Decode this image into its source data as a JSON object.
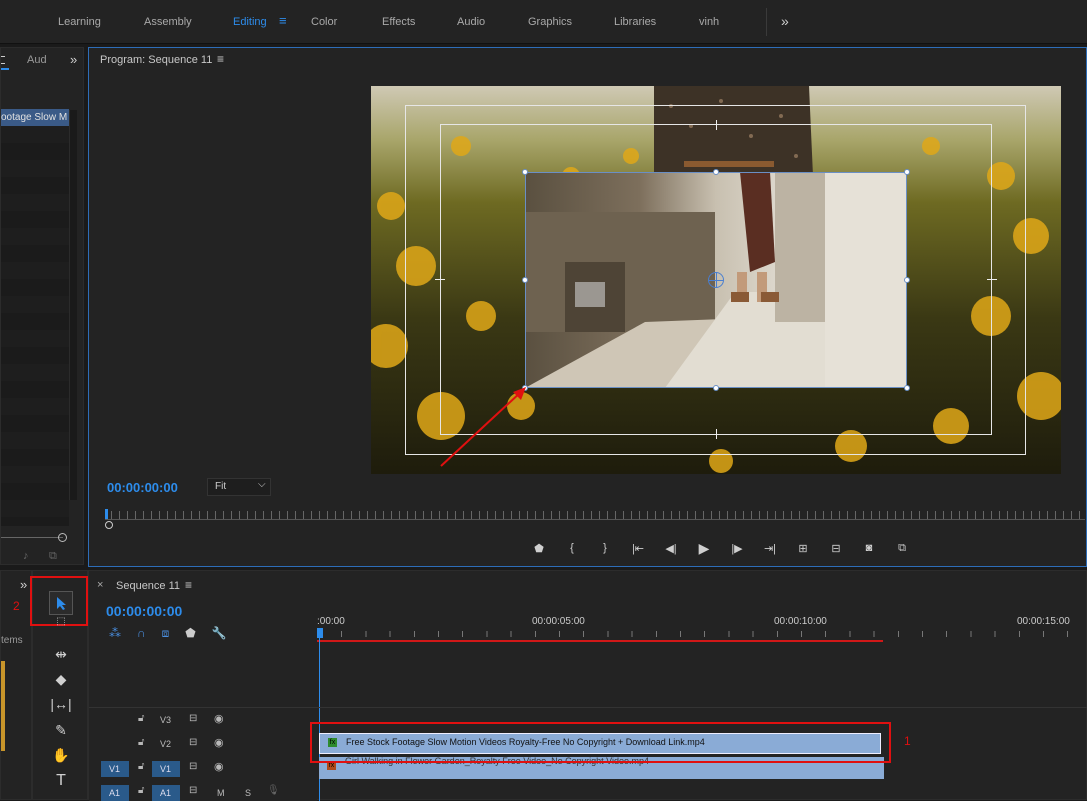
{
  "workspaces": {
    "items": [
      "Learning",
      "Assembly",
      "Editing",
      "Color",
      "Effects",
      "Audio",
      "Graphics",
      "Libraries",
      "vinh"
    ],
    "active": "Editing",
    "more": "»"
  },
  "left_panel": {
    "tab_partial": "Aud",
    "more": "»",
    "clip_partial": "ootage Slow M"
  },
  "program": {
    "title": "Program: Sequence 11",
    "menu": "≡",
    "timecode": "00:00:00:00",
    "zoom": "Fit",
    "zoom_arrow": "⌵"
  },
  "annotations": {
    "label_1": "1",
    "label_2": "2"
  },
  "tools_panel": {
    "more": "»",
    "items_partial": "tems"
  },
  "timeline": {
    "close": "×",
    "title": "Sequence 11",
    "menu": "≡",
    "timecode": "00:00:00:00",
    "ruler": [
      ":00:00",
      "00:00:05:00",
      "00:00:10:00",
      "00:00:15:00"
    ],
    "tracks": {
      "v3": "V3",
      "v2": "V2",
      "v1": "V1",
      "v1_src": "V1",
      "a1": "A1",
      "a1_src": "A1",
      "m": "M",
      "s": "S"
    },
    "clip_v2": "Free Stock Footage Slow Motion Videos Royalty-Free No Copyright + Download Link.mp4",
    "clip_v1": "Girl Walking in Flower Garden_Royalty Free Video_No Copyright Video.mp4",
    "fx": "fx"
  },
  "colors": {
    "accent": "#2d8ceb",
    "clip": "#8aabd6",
    "annotation": "#e01010"
  }
}
